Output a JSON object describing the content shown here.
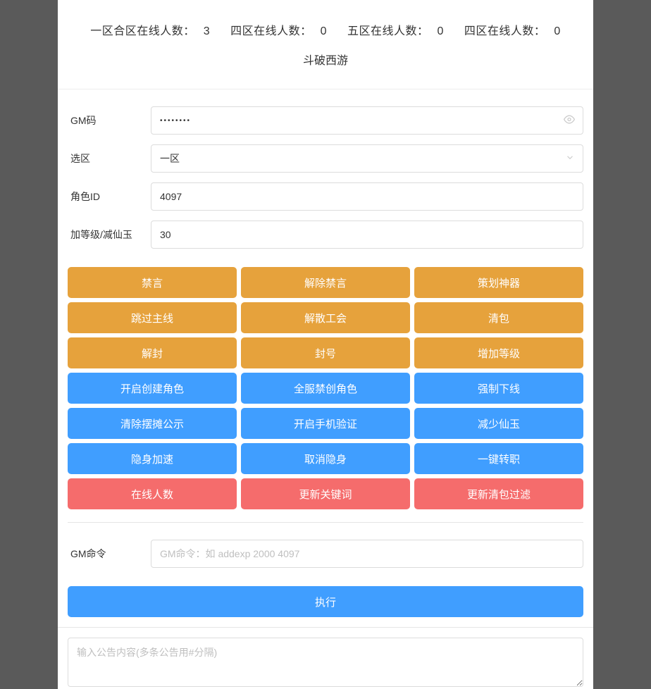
{
  "header": {
    "stats": [
      {
        "label": "一区合区在线人数：",
        "value": "3"
      },
      {
        "label": "四区在线人数：",
        "value": "0"
      },
      {
        "label": "五区在线人数：",
        "value": "0"
      },
      {
        "label": "四区在线人数：",
        "value": "0"
      }
    ],
    "title": "斗破西游"
  },
  "form": {
    "gm_code": {
      "label": "GM码",
      "value": "••••••••",
      "type": "password"
    },
    "zone": {
      "label": "选区",
      "value": "一区"
    },
    "role_id": {
      "label": "角色ID",
      "value": "4097"
    },
    "level_jade": {
      "label": "加等级/减仙玉",
      "value": "30"
    }
  },
  "buttons": {
    "rows": [
      {
        "color": "orange",
        "items": [
          "禁言",
          "解除禁言",
          "策划神器"
        ]
      },
      {
        "color": "orange",
        "items": [
          "跳过主线",
          "解散工会",
          "清包"
        ]
      },
      {
        "color": "orange",
        "items": [
          "解封",
          "封号",
          "增加等级"
        ]
      },
      {
        "color": "blue",
        "items": [
          "开启创建角色",
          "全服禁创角色",
          "强制下线"
        ]
      },
      {
        "color": "blue",
        "items": [
          "清除摆摊公示",
          "开启手机验证",
          "减少仙玉"
        ]
      },
      {
        "color": "blue",
        "items": [
          "隐身加速",
          "取消隐身",
          "一键转职"
        ]
      },
      {
        "color": "red",
        "items": [
          "在线人数",
          "更新关键词",
          "更新清包过滤"
        ]
      }
    ]
  },
  "cmd": {
    "label": "GM命令",
    "placeholder": "GM命令：如 addexp 2000 4097",
    "value": "",
    "execute": "执行"
  },
  "announce": {
    "placeholder": "输入公告内容(多条公告用#分隔)",
    "value": ""
  }
}
